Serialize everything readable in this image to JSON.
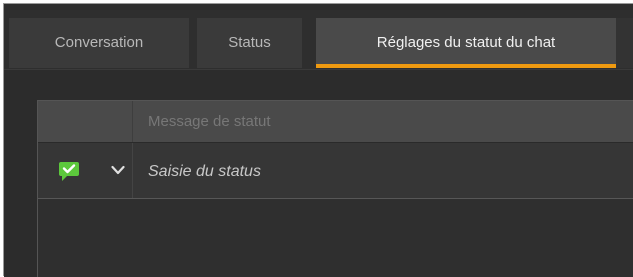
{
  "tabs": [
    {
      "label": "Conversation",
      "active": false
    },
    {
      "label": "Status",
      "active": false
    },
    {
      "label": "Réglages du statut du chat",
      "active": true
    }
  ],
  "accent_color": "#ef9a10",
  "status_list": {
    "header": {
      "message_column": "Message de statut"
    },
    "rows": [
      {
        "icon": "chat-bubble-check-icon",
        "icon_color": "#5cc83c",
        "dropdown_icon": "chevron-down-icon",
        "message_placeholder": "Saisie du status"
      }
    ]
  }
}
